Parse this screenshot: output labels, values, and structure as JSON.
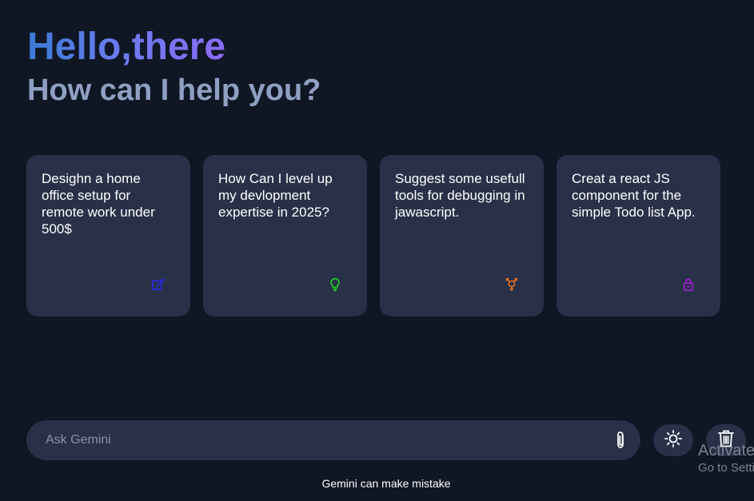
{
  "greeting": {
    "hello": "Hello,there",
    "subtitle": "How can I help you?"
  },
  "cards": [
    {
      "text": "Desighn a home office setup for remote work under 500$",
      "icon": "edit-icon",
      "icon_color": "#2a2adf"
    },
    {
      "text": "How Can I level up my devlopment expertise in 2025?",
      "icon": "lightbulb-icon",
      "icon_color": "#22d02a"
    },
    {
      "text": "Suggest some usefull tools for debugging in jawascript.",
      "icon": "gender-icon",
      "icon_color": "#e8731e"
    },
    {
      "text": "Creat a react JS component for the simple Todo list App.",
      "icon": "lock-icon",
      "icon_color": "#a21fd8"
    }
  ],
  "prompt": {
    "placeholder": "Ask Gemini",
    "attach_icon": "paperclip-icon"
  },
  "actions": {
    "theme_icon": "sun-icon",
    "delete_icon": "trash-icon"
  },
  "disclaimer": "Gemini can make mistake",
  "watermark": {
    "title": "Activate",
    "subtitle": "Go to Setti"
  },
  "colors": {
    "background": "#0f1624",
    "card": "#283148",
    "gradient_start": "#3a7bd5",
    "gradient_end": "#8b6cf5",
    "subtitle": "#8fa0c2"
  }
}
